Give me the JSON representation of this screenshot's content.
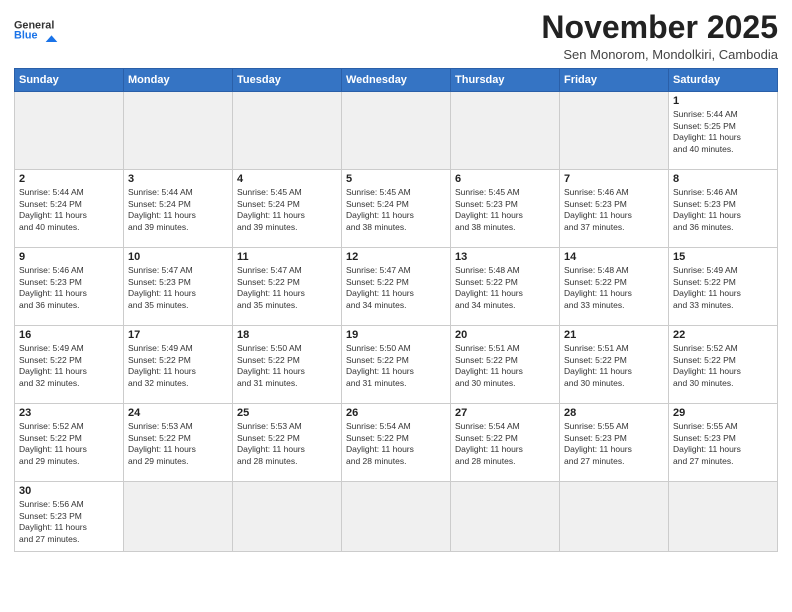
{
  "header": {
    "logo_line1": "General",
    "logo_line2": "Blue",
    "month": "November 2025",
    "location": "Sen Monorom, Mondolkiri, Cambodia"
  },
  "weekdays": [
    "Sunday",
    "Monday",
    "Tuesday",
    "Wednesday",
    "Thursday",
    "Friday",
    "Saturday"
  ],
  "weeks": [
    [
      {
        "day": "",
        "info": "",
        "empty": true
      },
      {
        "day": "",
        "info": "",
        "empty": true
      },
      {
        "day": "",
        "info": "",
        "empty": true
      },
      {
        "day": "",
        "info": "",
        "empty": true
      },
      {
        "day": "",
        "info": "",
        "empty": true
      },
      {
        "day": "",
        "info": "",
        "empty": true
      },
      {
        "day": "1",
        "info": "Sunrise: 5:44 AM\nSunset: 5:25 PM\nDaylight: 11 hours\nand 40 minutes."
      }
    ],
    [
      {
        "day": "2",
        "info": "Sunrise: 5:44 AM\nSunset: 5:24 PM\nDaylight: 11 hours\nand 40 minutes."
      },
      {
        "day": "3",
        "info": "Sunrise: 5:44 AM\nSunset: 5:24 PM\nDaylight: 11 hours\nand 39 minutes."
      },
      {
        "day": "4",
        "info": "Sunrise: 5:45 AM\nSunset: 5:24 PM\nDaylight: 11 hours\nand 39 minutes."
      },
      {
        "day": "5",
        "info": "Sunrise: 5:45 AM\nSunset: 5:24 PM\nDaylight: 11 hours\nand 38 minutes."
      },
      {
        "day": "6",
        "info": "Sunrise: 5:45 AM\nSunset: 5:23 PM\nDaylight: 11 hours\nand 38 minutes."
      },
      {
        "day": "7",
        "info": "Sunrise: 5:46 AM\nSunset: 5:23 PM\nDaylight: 11 hours\nand 37 minutes."
      },
      {
        "day": "8",
        "info": "Sunrise: 5:46 AM\nSunset: 5:23 PM\nDaylight: 11 hours\nand 36 minutes."
      }
    ],
    [
      {
        "day": "9",
        "info": "Sunrise: 5:46 AM\nSunset: 5:23 PM\nDaylight: 11 hours\nand 36 minutes."
      },
      {
        "day": "10",
        "info": "Sunrise: 5:47 AM\nSunset: 5:23 PM\nDaylight: 11 hours\nand 35 minutes."
      },
      {
        "day": "11",
        "info": "Sunrise: 5:47 AM\nSunset: 5:22 PM\nDaylight: 11 hours\nand 35 minutes."
      },
      {
        "day": "12",
        "info": "Sunrise: 5:47 AM\nSunset: 5:22 PM\nDaylight: 11 hours\nand 34 minutes."
      },
      {
        "day": "13",
        "info": "Sunrise: 5:48 AM\nSunset: 5:22 PM\nDaylight: 11 hours\nand 34 minutes."
      },
      {
        "day": "14",
        "info": "Sunrise: 5:48 AM\nSunset: 5:22 PM\nDaylight: 11 hours\nand 33 minutes."
      },
      {
        "day": "15",
        "info": "Sunrise: 5:49 AM\nSunset: 5:22 PM\nDaylight: 11 hours\nand 33 minutes."
      }
    ],
    [
      {
        "day": "16",
        "info": "Sunrise: 5:49 AM\nSunset: 5:22 PM\nDaylight: 11 hours\nand 32 minutes."
      },
      {
        "day": "17",
        "info": "Sunrise: 5:49 AM\nSunset: 5:22 PM\nDaylight: 11 hours\nand 32 minutes."
      },
      {
        "day": "18",
        "info": "Sunrise: 5:50 AM\nSunset: 5:22 PM\nDaylight: 11 hours\nand 31 minutes."
      },
      {
        "day": "19",
        "info": "Sunrise: 5:50 AM\nSunset: 5:22 PM\nDaylight: 11 hours\nand 31 minutes."
      },
      {
        "day": "20",
        "info": "Sunrise: 5:51 AM\nSunset: 5:22 PM\nDaylight: 11 hours\nand 30 minutes."
      },
      {
        "day": "21",
        "info": "Sunrise: 5:51 AM\nSunset: 5:22 PM\nDaylight: 11 hours\nand 30 minutes."
      },
      {
        "day": "22",
        "info": "Sunrise: 5:52 AM\nSunset: 5:22 PM\nDaylight: 11 hours\nand 30 minutes."
      }
    ],
    [
      {
        "day": "23",
        "info": "Sunrise: 5:52 AM\nSunset: 5:22 PM\nDaylight: 11 hours\nand 29 minutes."
      },
      {
        "day": "24",
        "info": "Sunrise: 5:53 AM\nSunset: 5:22 PM\nDaylight: 11 hours\nand 29 minutes."
      },
      {
        "day": "25",
        "info": "Sunrise: 5:53 AM\nSunset: 5:22 PM\nDaylight: 11 hours\nand 28 minutes."
      },
      {
        "day": "26",
        "info": "Sunrise: 5:54 AM\nSunset: 5:22 PM\nDaylight: 11 hours\nand 28 minutes."
      },
      {
        "day": "27",
        "info": "Sunrise: 5:54 AM\nSunset: 5:22 PM\nDaylight: 11 hours\nand 28 minutes."
      },
      {
        "day": "28",
        "info": "Sunrise: 5:55 AM\nSunset: 5:23 PM\nDaylight: 11 hours\nand 27 minutes."
      },
      {
        "day": "29",
        "info": "Sunrise: 5:55 AM\nSunset: 5:23 PM\nDaylight: 11 hours\nand 27 minutes."
      }
    ],
    [
      {
        "day": "30",
        "info": "Sunrise: 5:56 AM\nSunset: 5:23 PM\nDaylight: 11 hours\nand 27 minutes.",
        "last": true
      },
      {
        "day": "",
        "info": "",
        "empty": true,
        "last": true
      },
      {
        "day": "",
        "info": "",
        "empty": true,
        "last": true
      },
      {
        "day": "",
        "info": "",
        "empty": true,
        "last": true
      },
      {
        "day": "",
        "info": "",
        "empty": true,
        "last": true
      },
      {
        "day": "",
        "info": "",
        "empty": true,
        "last": true
      },
      {
        "day": "",
        "info": "",
        "empty": true,
        "last": true
      }
    ]
  ]
}
